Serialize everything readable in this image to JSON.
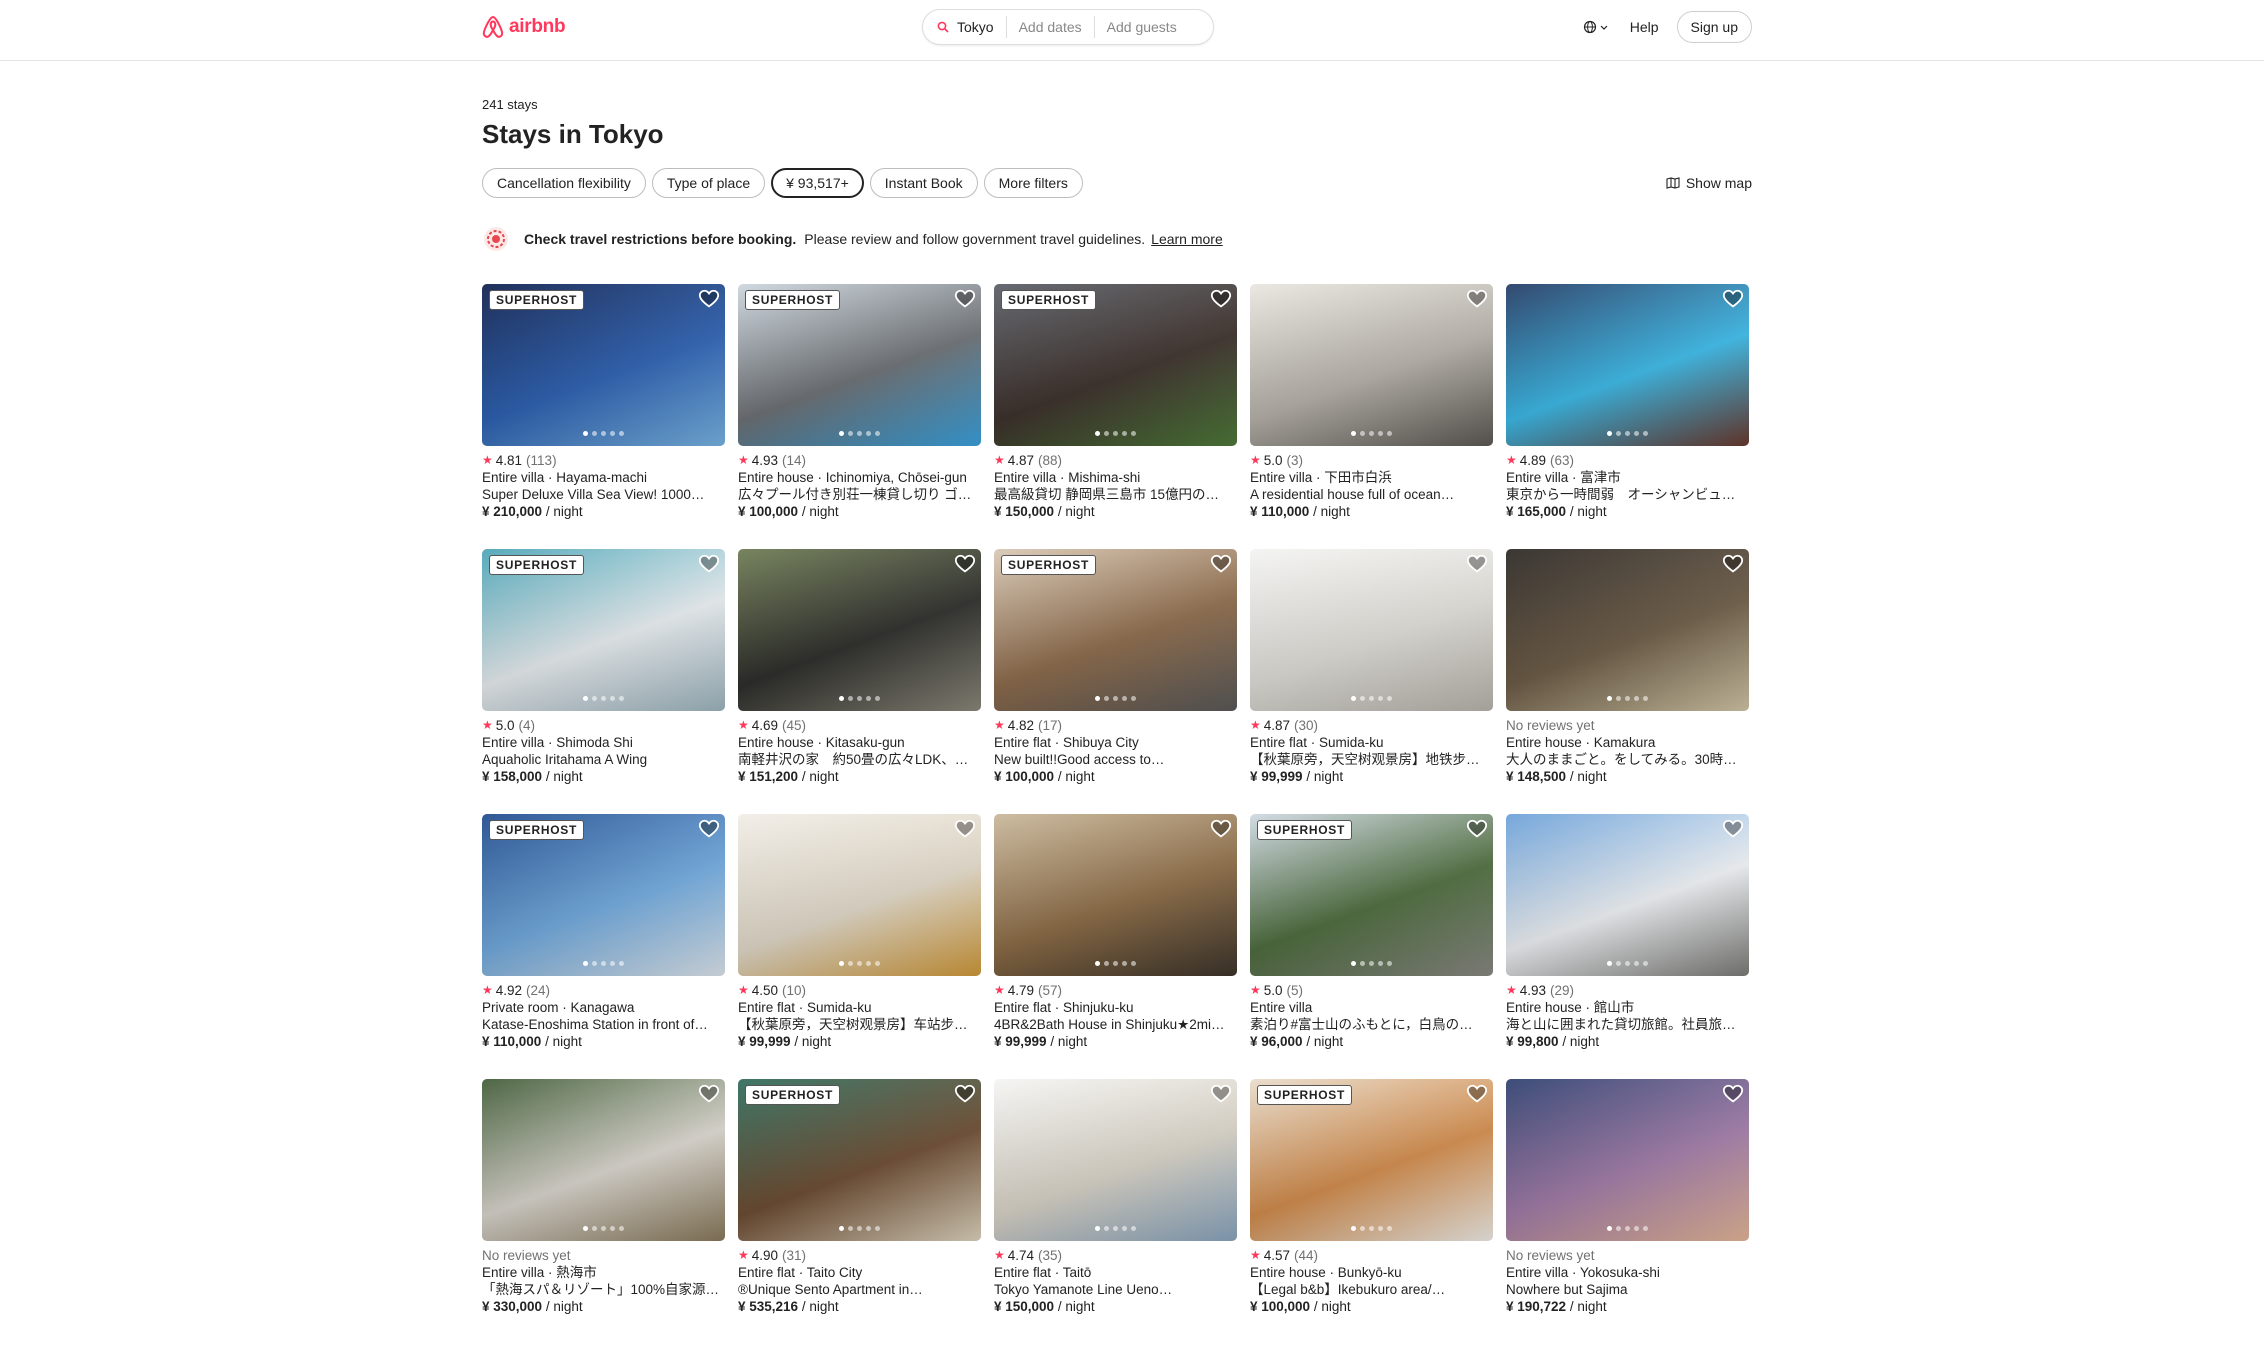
{
  "header": {
    "logo": "airbnb",
    "search": {
      "location": "Tokyo",
      "dates": "Add dates",
      "guests": "Add guests"
    },
    "help": "Help",
    "signup": "Sign up"
  },
  "results": {
    "count": "241 stays",
    "title": "Stays in Tokyo"
  },
  "filters": [
    "Cancellation flexibility",
    "Type of place",
    "¥ 93,517+",
    "Instant Book",
    "More filters"
  ],
  "show_map": "Show map",
  "notice": {
    "bold": "Check travel restrictions before booking.",
    "text": "Please review and follow government travel guidelines.",
    "link": "Learn more"
  },
  "per_night": "/ night",
  "listings": [
    {
      "superhost": true,
      "score": "4.81",
      "reviews": "(113)",
      "type": "Entire villa · Hayama-machi",
      "title": "Super Deluxe Villa Sea View! 1000…",
      "price": "¥ 210,000",
      "palette": [
        "#0d1f4d",
        "#2b5fb0",
        "#7ab6e6"
      ]
    },
    {
      "superhost": true,
      "score": "4.93",
      "reviews": "(14)",
      "type": "Entire house · Ichinomiya, Chōsei-gun",
      "title": "広々プール付き別荘一棟貸し切り ゴ…",
      "price": "¥ 100,000",
      "palette": [
        "#cdd6de",
        "#6b6f73",
        "#3aa3e0"
      ]
    },
    {
      "superhost": true,
      "score": "4.87",
      "reviews": "(88)",
      "type": "Entire villa · Mishima-shi",
      "title": "最高級貸切 静岡県三島市 15億円の…",
      "price": "¥ 150,000",
      "palette": [
        "#5a5e66",
        "#3b2f2a",
        "#4f7b3a"
      ]
    },
    {
      "superhost": false,
      "score": "5.0",
      "reviews": "(3)",
      "type": "Entire villa · 下田市白浜",
      "title": "A residential house full of ocean…",
      "price": "¥ 110,000",
      "palette": [
        "#e9e6e0",
        "#b5b0a8",
        "#5d5a55"
      ]
    },
    {
      "superhost": false,
      "score": "4.89",
      "reviews": "(63)",
      "type": "Entire villa · 富津市",
      "title": "東京から一時間弱　オーシャンビュ…",
      "price": "¥ 165,000",
      "palette": [
        "#223a63",
        "#3ab8e6",
        "#6b3a2e"
      ]
    },
    {
      "superhost": true,
      "score": "5.0",
      "reviews": "(4)",
      "type": "Entire villa · Shimoda Shi",
      "title": "Aquaholic Iritahama A Wing",
      "price": "¥ 158,000",
      "palette": [
        "#4aa3b5",
        "#e7ecef",
        "#9fb6c0"
      ]
    },
    {
      "superhost": false,
      "score": "4.69",
      "reviews": "(45)",
      "type": "Entire house · Kitasaku-gun",
      "title": "南軽井沢の家　約50畳の広々LDK、…",
      "price": "¥ 151,200",
      "palette": [
        "#6c7a52",
        "#2b2b28",
        "#8c8a7c"
      ]
    },
    {
      "superhost": true,
      "score": "4.82",
      "reviews": "(17)",
      "type": "Entire flat · Shibuya City",
      "title": "New built!!Good access to…",
      "price": "¥ 100,000",
      "palette": [
        "#d8c8b4",
        "#8c6a4a",
        "#5a5a5a"
      ]
    },
    {
      "superhost": false,
      "score": "4.87",
      "reviews": "(30)",
      "type": "Entire flat · Sumida-ku",
      "title": "【秋葉原旁，天空树观景房】地铁步…",
      "price": "¥ 99,999",
      "palette": [
        "#f3f3f1",
        "#dedcd6",
        "#b9b6ae"
      ]
    },
    {
      "superhost": false,
      "no_reviews": "No reviews yet",
      "type": "Entire house · Kamakura",
      "title": "大人のままごと。をしてみる。30時…",
      "price": "¥ 148,500",
      "palette": [
        "#2a2622",
        "#6b5a45",
        "#d4c8a8"
      ]
    },
    {
      "superhost": true,
      "score": "4.92",
      "reviews": "(24)",
      "type": "Private room · Kanagawa",
      "title": "Katase-Enoshima Station in front of…",
      "price": "¥ 110,000",
      "palette": [
        "#1e4a8c",
        "#6fa8dc",
        "#dfe8ef"
      ]
    },
    {
      "superhost": false,
      "score": "4.50",
      "reviews": "(10)",
      "type": "Entire flat · Sumida-ku",
      "title": "【秋葉原旁，天空树观景房】车站步…",
      "price": "¥ 99,999",
      "palette": [
        "#f1ede6",
        "#e0d8c8",
        "#d19a3a"
      ]
    },
    {
      "superhost": false,
      "score": "4.79",
      "reviews": "(57)",
      "type": "Entire flat · Shinjuku-ku",
      "title": "4BR&2Bath House in Shinjuku★2mi…",
      "price": "¥ 99,999",
      "palette": [
        "#c9b79a",
        "#8a6a44",
        "#3d352c"
      ]
    },
    {
      "superhost": true,
      "score": "5.0",
      "reviews": "(5)",
      "type": "Entire villa",
      "title": "素泊り#富士山のふもとに，白鳥の…",
      "price": "¥ 96,000",
      "palette": [
        "#cfd9e3",
        "#4c6b3c",
        "#8a8a84"
      ]
    },
    {
      "superhost": false,
      "score": "4.93",
      "reviews": "(29)",
      "type": "Entire house · 館山市",
      "title": "海と山に囲まれた貸切旅館。社員旅…",
      "price": "¥ 99,800",
      "palette": [
        "#6aa0d8",
        "#eef1f4",
        "#7c7c78"
      ]
    },
    {
      "superhost": false,
      "no_reviews": "No reviews yet",
      "type": "Entire villa · 熱海市",
      "title": "「熱海スパ＆リゾート」100%自家源…",
      "price": "¥ 330,000",
      "palette": [
        "#3f5a35",
        "#d8d4cc",
        "#8a7a5c"
      ]
    },
    {
      "superhost": true,
      "score": "4.90",
      "reviews": "(31)",
      "type": "Entire flat · Taito City",
      "title": "®Unique Sento Apartment in…",
      "price": "¥ 535,216",
      "palette": [
        "#2f6b5a",
        "#6b4a30",
        "#e0d6c0"
      ]
    },
    {
      "superhost": false,
      "score": "4.74",
      "reviews": "(35)",
      "type": "Entire flat · Taitō",
      "title": "Tokyo Yamanote Line Ueno…",
      "price": "¥ 150,000",
      "palette": [
        "#f4f4f2",
        "#d8d2c6",
        "#8aa6bf"
      ]
    },
    {
      "superhost": true,
      "score": "4.57",
      "reviews": "(44)",
      "type": "Entire house · Bunkyō-ku",
      "title": "【Legal b&b】Ikebukuro area/…",
      "price": "¥ 100,000",
      "palette": [
        "#e8dccb",
        "#d08a4a",
        "#f2efe9"
      ]
    },
    {
      "superhost": false,
      "no_reviews": "No reviews yet",
      "type": "Entire villa · Yokosuka-shi",
      "title": "Nowhere but Sajima",
      "price": "¥ 190,722",
      "palette": [
        "#2c3e6e",
        "#a07aa6",
        "#e6b89a"
      ]
    }
  ]
}
